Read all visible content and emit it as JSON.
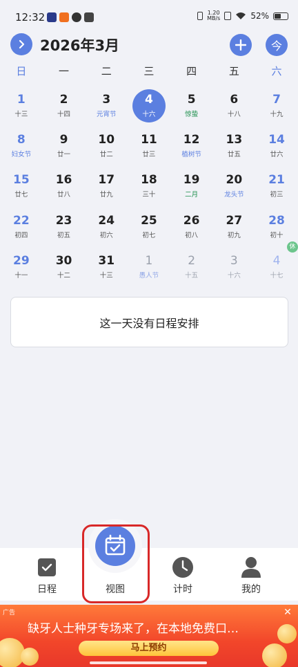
{
  "status_bar": {
    "time": "12:32",
    "net_speed_top": "1.20",
    "net_speed_bottom": "MB/s",
    "battery": "52%",
    "battery_level": 0.52
  },
  "header": {
    "title": "2026年3月",
    "today_label": "今",
    "add_label": "+",
    "next_label": "›"
  },
  "weekdays": [
    "日",
    "一",
    "二",
    "三",
    "四",
    "五",
    "六"
  ],
  "calendar": {
    "rows": [
      [
        {
          "num": "1",
          "sub": "十三"
        },
        {
          "num": "2",
          "sub": "十四"
        },
        {
          "num": "3",
          "sub": "元宵节",
          "festival": true
        },
        {
          "num": "4",
          "sub": "十六",
          "selected": true
        },
        {
          "num": "5",
          "sub": "惊蛰",
          "solar": true
        },
        {
          "num": "6",
          "sub": "十八"
        },
        {
          "num": "7",
          "sub": "十九"
        }
      ],
      [
        {
          "num": "8",
          "sub": "妇女节",
          "festival": true
        },
        {
          "num": "9",
          "sub": "廿一"
        },
        {
          "num": "10",
          "sub": "廿二"
        },
        {
          "num": "11",
          "sub": "廿三"
        },
        {
          "num": "12",
          "sub": "植树节",
          "festival": true
        },
        {
          "num": "13",
          "sub": "廿五"
        },
        {
          "num": "14",
          "sub": "廿六"
        }
      ],
      [
        {
          "num": "15",
          "sub": "廿七"
        },
        {
          "num": "16",
          "sub": "廿八"
        },
        {
          "num": "17",
          "sub": "廿九"
        },
        {
          "num": "18",
          "sub": "三十"
        },
        {
          "num": "19",
          "sub": "二月",
          "solar": true
        },
        {
          "num": "20",
          "sub": "龙头节",
          "festival": true
        },
        {
          "num": "21",
          "sub": "初三"
        }
      ],
      [
        {
          "num": "22",
          "sub": "初四"
        },
        {
          "num": "23",
          "sub": "初五"
        },
        {
          "num": "24",
          "sub": "初六"
        },
        {
          "num": "25",
          "sub": "初七"
        },
        {
          "num": "26",
          "sub": "初八"
        },
        {
          "num": "27",
          "sub": "初九"
        },
        {
          "num": "28",
          "sub": "初十"
        }
      ],
      [
        {
          "num": "29",
          "sub": "十一"
        },
        {
          "num": "30",
          "sub": "十二"
        },
        {
          "num": "31",
          "sub": "十三"
        },
        {
          "num": "1",
          "sub": "愚人节",
          "other": true,
          "festival": true
        },
        {
          "num": "2",
          "sub": "十五",
          "other": true
        },
        {
          "num": "3",
          "sub": "十六",
          "other": true
        },
        {
          "num": "4",
          "sub": "十七",
          "other": true,
          "badge": "休"
        }
      ]
    ]
  },
  "empty_message": "这一天没有日程安排",
  "tabs": [
    {
      "label": "日程",
      "icon": "checkbox-icon"
    },
    {
      "label": "视图",
      "icon": "calendar-check-icon",
      "active": true
    },
    {
      "label": "计时",
      "icon": "clock-icon"
    },
    {
      "label": "我的",
      "icon": "person-icon"
    }
  ],
  "ad": {
    "tag": "广告",
    "headline": "缺牙人士种牙专场来了，在本地免费口…",
    "cta": "马上预约",
    "close": "✕"
  },
  "colors": {
    "accent": "#5b7fe0",
    "background": "#f1f2f7",
    "highlight": "#d82828",
    "solar_term": "#1c8f4b"
  }
}
